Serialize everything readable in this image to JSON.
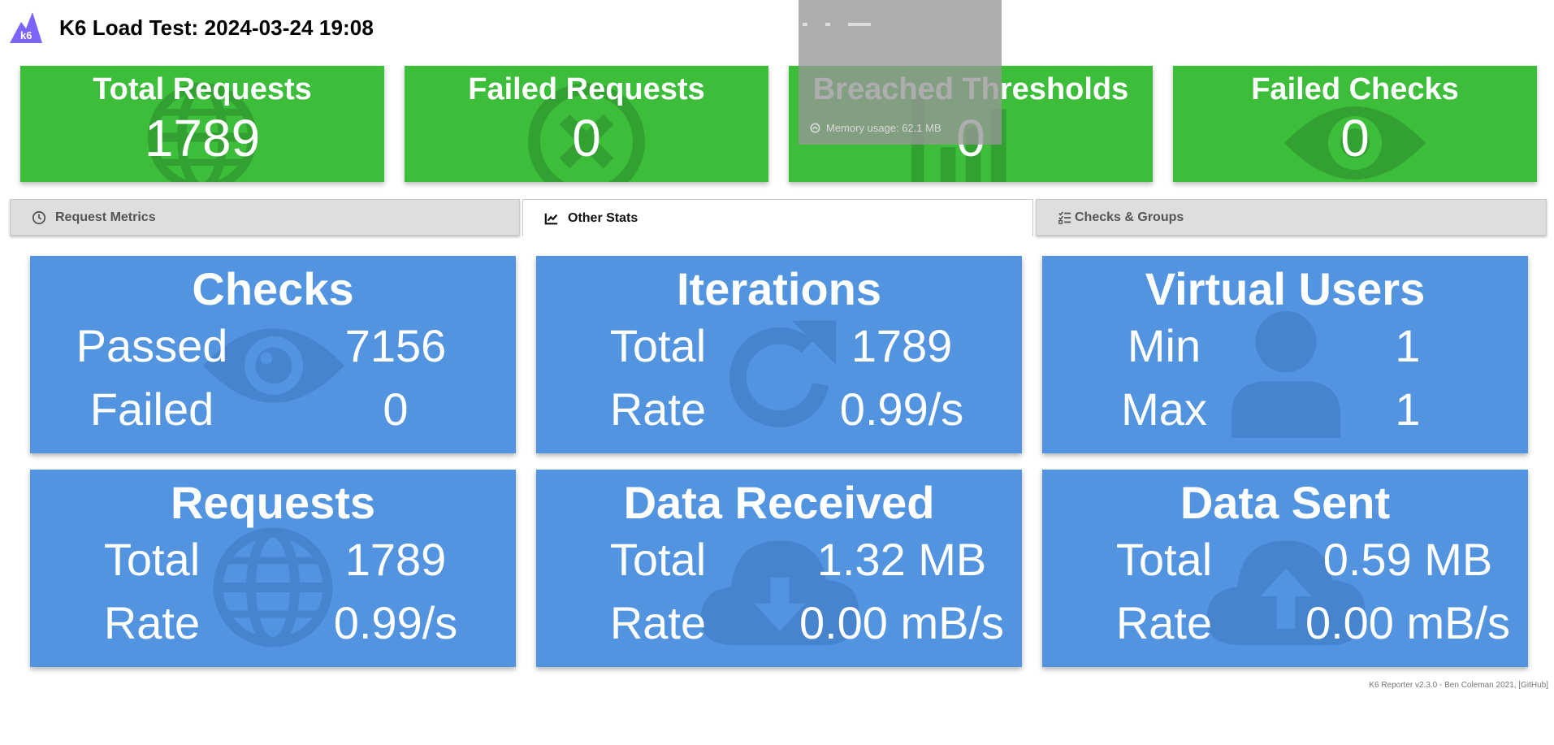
{
  "header": {
    "title": "K6 Load Test: 2024-03-24 19:08",
    "logo_text": "k6"
  },
  "summary": [
    {
      "label": "Total Requests",
      "value": "1789",
      "icon": "globe-icon"
    },
    {
      "label": "Failed Requests",
      "value": "0",
      "icon": "times-circle-icon"
    },
    {
      "label": "Breached Thresholds",
      "value": "0",
      "icon": "chart-icon"
    },
    {
      "label": "Failed Checks",
      "value": "0",
      "icon": "eye-icon"
    }
  ],
  "tabs": [
    {
      "label": "Request Metrics",
      "icon": "clock-icon",
      "active": false
    },
    {
      "label": "Other Stats",
      "icon": "line-chart-icon",
      "active": true
    },
    {
      "label": "Checks & Groups",
      "icon": "tasks-icon",
      "active": false
    }
  ],
  "cards": {
    "checks": {
      "title": "Checks",
      "row1_label": "Passed",
      "row1_value": "7156",
      "row2_label": "Failed",
      "row2_value": "0",
      "icon": "eye-icon"
    },
    "iterations": {
      "title": "Iterations",
      "row1_label": "Total",
      "row1_value": "1789",
      "row2_label": "Rate",
      "row2_value": "0.99/s",
      "icon": "redo-icon"
    },
    "vus": {
      "title": "Virtual Users",
      "row1_label": "Min",
      "row1_value": "1",
      "row2_label": "Max",
      "row2_value": "1",
      "icon": "user-icon"
    },
    "requests": {
      "title": "Requests",
      "row1_label": "Total",
      "row1_value": "1789",
      "row2_label": "Rate",
      "row2_value": "0.99/s",
      "icon": "globe-icon"
    },
    "received": {
      "title": "Data Received",
      "row1_label": "Total",
      "row1_value": "1.32 MB",
      "row2_label": "Rate",
      "row2_value": "0.00 mB/s",
      "icon": "cloud-download-icon"
    },
    "sent": {
      "title": "Data Sent",
      "row1_label": "Total",
      "row1_value": "0.59 MB",
      "row2_label": "Rate",
      "row2_value": "0.00 mB/s",
      "icon": "cloud-upload-icon"
    }
  },
  "colors": {
    "success": "#3cbe3a",
    "card": "#5394e1",
    "logo": "#7d64ff"
  },
  "overlay": {
    "memory_text": "Memory usage: 62.1 MB"
  },
  "footer": {
    "text": "K6 Reporter v2.3.0 - Ben Coleman 2021, [GitHub]"
  }
}
